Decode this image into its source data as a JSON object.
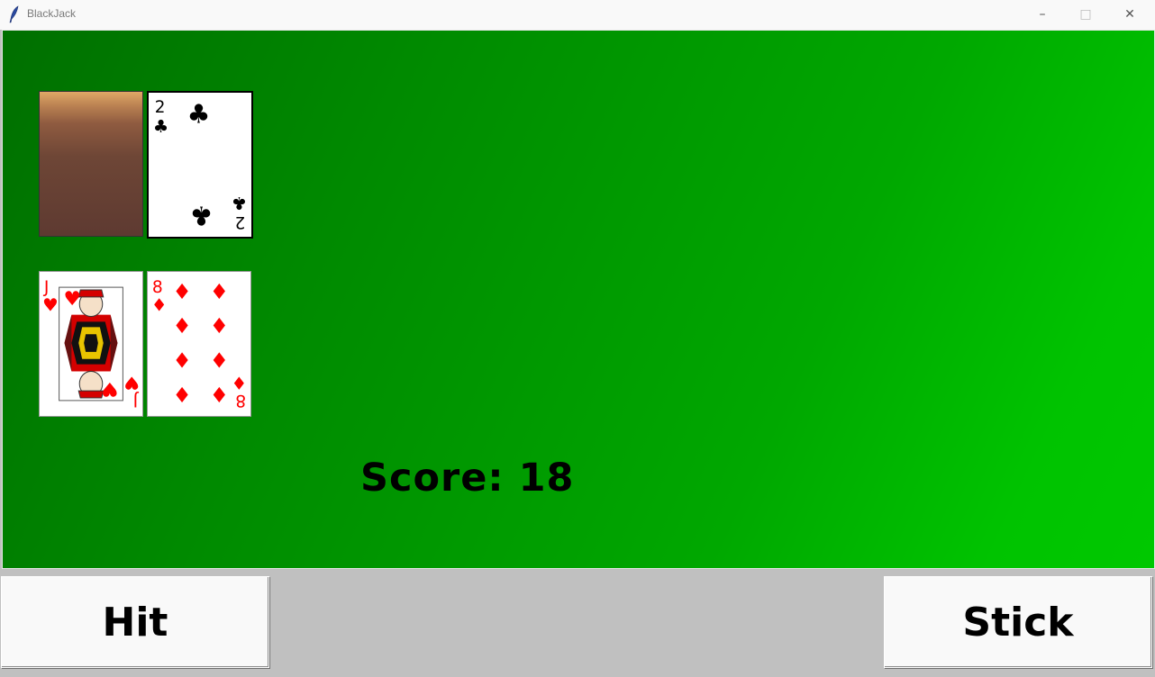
{
  "window": {
    "title": "BlackJack",
    "minimize_glyph": "–",
    "maximize_glyph": "□",
    "close_glyph": "✕"
  },
  "colors": {
    "felt_dark": "#006f00",
    "felt_light": "#00c800",
    "bottom_bar": "#c0c0c0",
    "red_suit": "#ff0000",
    "black_suit": "#000000"
  },
  "dealer_hand": [
    {
      "face_down": true,
      "back_pattern": "brown-gradient"
    },
    {
      "rank": "2",
      "suit": "clubs",
      "suit_glyph": "♣",
      "color": "#000000"
    }
  ],
  "player_hand": [
    {
      "rank": "J",
      "suit": "hearts",
      "suit_glyph": "♥",
      "color": "#ff0000"
    },
    {
      "rank": "8",
      "suit": "diamonds",
      "suit_glyph": "♦",
      "color": "#ff0000"
    }
  ],
  "score": {
    "label": "Score:",
    "value": "18"
  },
  "buttons": {
    "hit": "Hit",
    "stick": "Stick"
  }
}
